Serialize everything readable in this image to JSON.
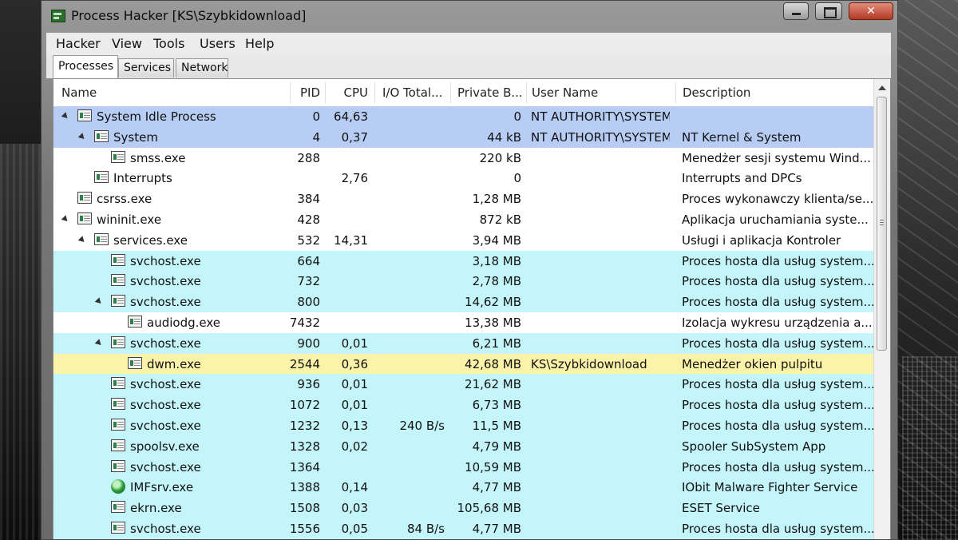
{
  "window": {
    "title": "Process Hacker [KS\\Szybkidownload]"
  },
  "menu": [
    "Hacker",
    "View",
    "Tools",
    "Users",
    "Help"
  ],
  "tabs": [
    {
      "label": "Processes",
      "active": true
    },
    {
      "label": "Services",
      "active": false
    },
    {
      "label": "Network",
      "active": false
    }
  ],
  "columns": {
    "name": "Name",
    "pid": "PID",
    "cpu": "CPU",
    "io": "I/O Total...",
    "private": "Private B...",
    "user": "User Name",
    "description": "Description"
  },
  "processes": [
    {
      "name": "System Idle Process",
      "pid": "0",
      "cpu": "64,63",
      "io": "",
      "private": "0",
      "user": "NT AUTHORITY\\SYSTEM",
      "description": "",
      "color": "blue",
      "level": 0,
      "expander": true,
      "icon": "process-icon"
    },
    {
      "name": "System",
      "pid": "4",
      "cpu": "0,37",
      "io": "",
      "private": "44 kB",
      "user": "NT AUTHORITY\\SYSTEM",
      "description": "NT Kernel & System",
      "color": "blue",
      "level": 1,
      "expander": true,
      "icon": "process-icon"
    },
    {
      "name": "smss.exe",
      "pid": "288",
      "cpu": "",
      "io": "",
      "private": "220 kB",
      "user": "",
      "description": "Menedżer sesji systemu Wind...",
      "color": "white",
      "level": 2,
      "expander": false,
      "icon": "process-icon"
    },
    {
      "name": "Interrupts",
      "pid": "",
      "cpu": "2,76",
      "io": "",
      "private": "0",
      "user": "",
      "description": "Interrupts and DPCs",
      "color": "white",
      "level": 1,
      "expander": false,
      "icon": "process-icon"
    },
    {
      "name": "csrss.exe",
      "pid": "384",
      "cpu": "",
      "io": "",
      "private": "1,28 MB",
      "user": "",
      "description": "Proces wykonawczy klienta/se...",
      "color": "white",
      "level": 0,
      "expander": false,
      "icon": "process-icon"
    },
    {
      "name": "wininit.exe",
      "pid": "428",
      "cpu": "",
      "io": "",
      "private": "872 kB",
      "user": "",
      "description": "Aplikacja uruchamiania syste...",
      "color": "white",
      "level": 0,
      "expander": true,
      "icon": "process-icon"
    },
    {
      "name": "services.exe",
      "pid": "532",
      "cpu": "14,31",
      "io": "",
      "private": "3,94 MB",
      "user": "",
      "description": "Usługi i aplikacja Kontroler",
      "color": "white",
      "level": 1,
      "expander": true,
      "icon": "process-icon"
    },
    {
      "name": "svchost.exe",
      "pid": "664",
      "cpu": "",
      "io": "",
      "private": "3,18 MB",
      "user": "",
      "description": "Proces hosta dla usług system...",
      "color": "cyan",
      "level": 2,
      "expander": false,
      "icon": "process-icon"
    },
    {
      "name": "svchost.exe",
      "pid": "732",
      "cpu": "",
      "io": "",
      "private": "2,78 MB",
      "user": "",
      "description": "Proces hosta dla usług system...",
      "color": "cyan",
      "level": 2,
      "expander": false,
      "icon": "process-icon"
    },
    {
      "name": "svchost.exe",
      "pid": "800",
      "cpu": "",
      "io": "",
      "private": "14,62 MB",
      "user": "",
      "description": "Proces hosta dla usług system...",
      "color": "cyan",
      "level": 2,
      "expander": true,
      "icon": "process-icon"
    },
    {
      "name": "audiodg.exe",
      "pid": "7432",
      "cpu": "",
      "io": "",
      "private": "13,38 MB",
      "user": "",
      "description": "Izolacja wykresu urządzenia a...",
      "color": "white",
      "level": 3,
      "expander": false,
      "icon": "process-icon"
    },
    {
      "name": "svchost.exe",
      "pid": "900",
      "cpu": "0,01",
      "io": "",
      "private": "6,21 MB",
      "user": "",
      "description": "Proces hosta dla usług system...",
      "color": "cyan",
      "level": 2,
      "expander": true,
      "icon": "process-icon"
    },
    {
      "name": "dwm.exe",
      "pid": "2544",
      "cpu": "0,36",
      "io": "",
      "private": "42,68 MB",
      "user": "KS\\Szybkidownload",
      "description": "Menedżer okien pulpitu",
      "color": "yellow",
      "level": 3,
      "expander": false,
      "icon": "process-icon"
    },
    {
      "name": "svchost.exe",
      "pid": "936",
      "cpu": "0,01",
      "io": "",
      "private": "21,62 MB",
      "user": "",
      "description": "Proces hosta dla usług system...",
      "color": "cyan",
      "level": 2,
      "expander": false,
      "icon": "process-icon"
    },
    {
      "name": "svchost.exe",
      "pid": "1072",
      "cpu": "0,01",
      "io": "",
      "private": "6,73 MB",
      "user": "",
      "description": "Proces hosta dla usług system...",
      "color": "cyan",
      "level": 2,
      "expander": false,
      "icon": "process-icon"
    },
    {
      "name": "svchost.exe",
      "pid": "1232",
      "cpu": "0,13",
      "io": "240 B/s",
      "private": "11,5 MB",
      "user": "",
      "description": "Proces hosta dla usług system...",
      "color": "cyan",
      "level": 2,
      "expander": false,
      "icon": "process-icon"
    },
    {
      "name": "spoolsv.exe",
      "pid": "1328",
      "cpu": "0,02",
      "io": "",
      "private": "4,79 MB",
      "user": "",
      "description": "Spooler SubSystem App",
      "color": "cyan",
      "level": 2,
      "expander": false,
      "icon": "process-icon"
    },
    {
      "name": "svchost.exe",
      "pid": "1364",
      "cpu": "",
      "io": "",
      "private": "10,59 MB",
      "user": "",
      "description": "Proces hosta dla usług system...",
      "color": "cyan",
      "level": 2,
      "expander": false,
      "icon": "process-icon"
    },
    {
      "name": "IMFsrv.exe",
      "pid": "1388",
      "cpu": "0,14",
      "io": "",
      "private": "4,77 MB",
      "user": "",
      "description": "IObit Malware Fighter Service",
      "color": "cyan",
      "level": 2,
      "expander": false,
      "icon": "globe-icon"
    },
    {
      "name": "ekrn.exe",
      "pid": "1508",
      "cpu": "0,03",
      "io": "",
      "private": "105,68 MB",
      "user": "",
      "description": "ESET Service",
      "color": "cyan",
      "level": 2,
      "expander": false,
      "icon": "process-icon"
    },
    {
      "name": "svchost.exe",
      "pid": "1556",
      "cpu": "0,05",
      "io": "84 B/s",
      "private": "4,77 MB",
      "user": "",
      "description": "Proces hosta dla usług system...",
      "color": "cyan",
      "level": 2,
      "expander": false,
      "icon": "process-icon"
    }
  ],
  "colors": {
    "blue": "#b7cdf4",
    "cyan": "#c4f5fb",
    "yellow": "#faf3a8",
    "white": "#ffffff"
  }
}
